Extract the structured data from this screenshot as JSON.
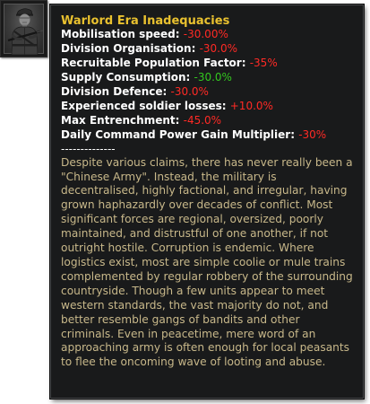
{
  "portrait": {
    "icon": "soldier-portrait-icon"
  },
  "tooltip": {
    "title": "Warlord Era Inadequacies",
    "modifiers": [
      {
        "label": "Mobilisation speed:",
        "value": "-30.00%",
        "sign": "negative"
      },
      {
        "label": "Division Organisation:",
        "value": "-30.0%",
        "sign": "negative"
      },
      {
        "label": "Recruitable Population Factor:",
        "value": "-35%",
        "sign": "negative"
      },
      {
        "label": "Supply Consumption:",
        "value": "-30.0%",
        "sign": "positive"
      },
      {
        "label": "Division Defence:",
        "value": "-30.0%",
        "sign": "negative"
      },
      {
        "label": "Experienced soldier losses:",
        "value": "+10.0%",
        "sign": "negative"
      },
      {
        "label": "Max Entrenchment:",
        "value": "-45.0%",
        "sign": "negative"
      },
      {
        "label": "Daily Command Power Gain Multiplier:",
        "value": "-30%",
        "sign": "negative"
      }
    ],
    "separator": "--------------",
    "description": "Despite various claims, there has never really been a \"Chinese Army\". Instead, the military is decentralised, highly factional, and irregular, having grown haphazardly over decades of conflict. Most significant forces are regional, oversized, poorly maintained, and distrustful of one another, if not outright hostile. Corruption is endemic. Where logistics exist, most are simple coolie or mule trains complemented by regular robbery of the surrounding countryside. Though a few units appear to meet western standards, the vast majority do not, and better resemble gangs of bandits and other criminals. Even in peacetime, mere word of an approaching army is often enough for local peasants to flee the oncoming wave of looting and abuse."
  },
  "colors": {
    "title": "#e9c12f",
    "negative": "#ff2a25",
    "positive": "#33c71f",
    "description": "#c8b88a",
    "background": "#191a1b"
  }
}
